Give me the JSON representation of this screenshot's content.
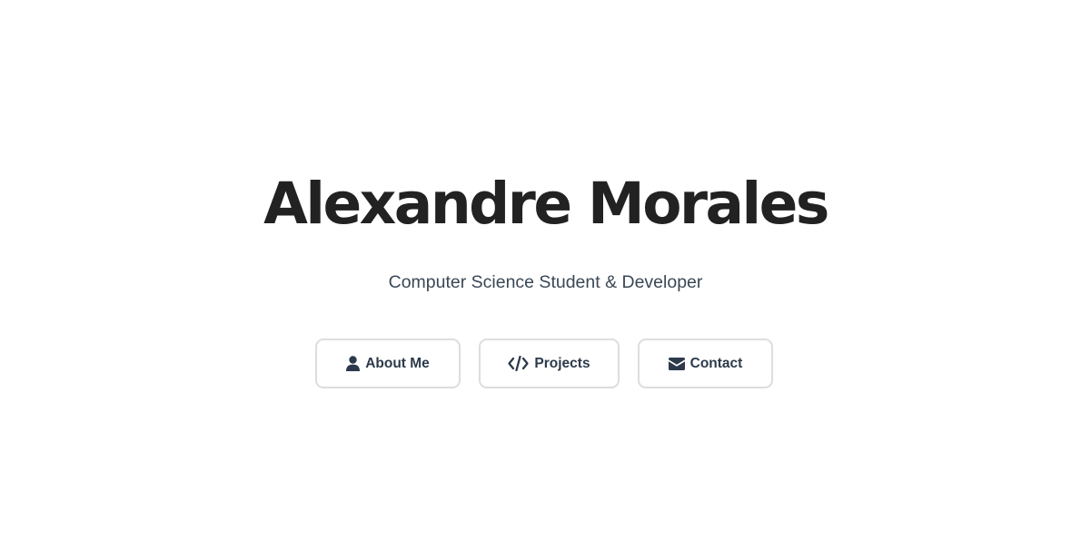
{
  "hero": {
    "name": "Alexandre Morales",
    "subtitle": "Computer Science Student & Developer"
  },
  "nav": {
    "buttons": [
      {
        "label": "About Me",
        "icon": "user-icon"
      },
      {
        "label": "Projects",
        "icon": "code-icon"
      },
      {
        "label": "Contact",
        "icon": "envelope-icon"
      }
    ]
  },
  "colors": {
    "background": "#ffffff",
    "heading": "#222222",
    "subtitle": "#3a4756",
    "button_text": "#2c3a4b",
    "button_border": "#dddddd"
  }
}
